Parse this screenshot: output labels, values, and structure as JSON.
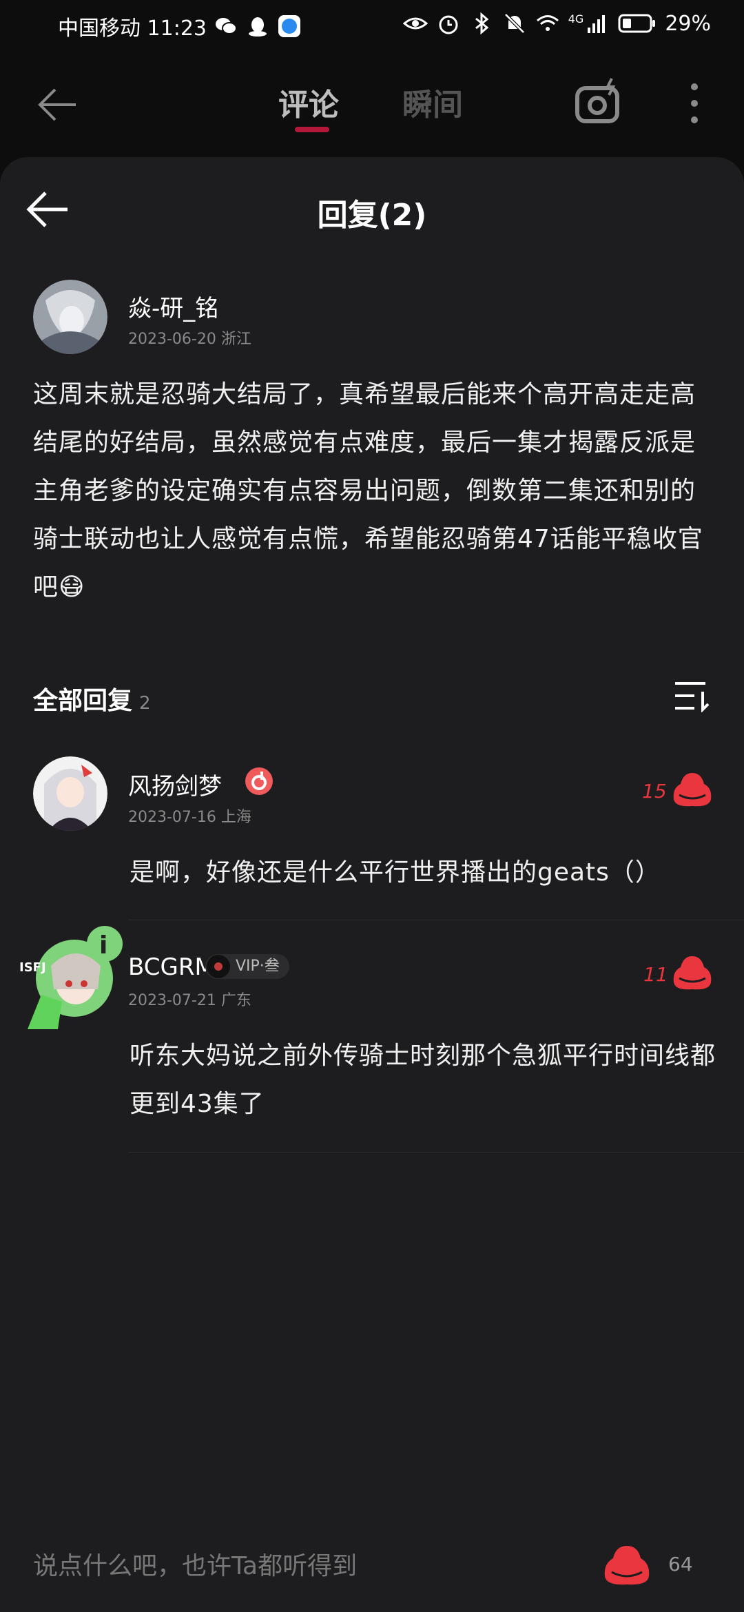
{
  "status_bar": {
    "carrier_time": "中国移动 11:23",
    "signal_label": "4G",
    "battery": "29%"
  },
  "top_nav": {
    "tabs": [
      {
        "label": "评论",
        "active": true
      },
      {
        "label": "瞬间",
        "active": false
      }
    ]
  },
  "panel": {
    "title": "回复(2)"
  },
  "original_comment": {
    "author": "焱-研_铭",
    "date_location": "2023-06-20  浙江",
    "text": "这周末就是忍骑大结局了，真希望最后能来个高开高走走高结尾的好结局，虽然感觉有点难度，最后一集才揭露反派是主角老爹的设定确实有点容易出问题，倒数第二集还和别的骑士联动也让人感觉有点慌，希望能忍骑第47话能平稳收官吧😷"
  },
  "replies_section": {
    "title": "全部回复",
    "count": "2"
  },
  "replies": [
    {
      "author": "风扬剑梦",
      "date_location": "2023-07-16  上海",
      "likes": "15",
      "text": "是啊，好像还是什么平行世界播出的geats（）"
    },
    {
      "author": "BCGRM",
      "vip_label": "VIP·叁",
      "avatar_badge": "ISFJ",
      "date_location": "2023-07-21  广东",
      "likes": "11",
      "text": "听东大妈说之前外传骑士时刻那个急狐平行时间线都更到43集了"
    }
  ],
  "bottom_bar": {
    "input_placeholder": "说点什么吧，也许Ta都听得到",
    "like_count": "64"
  },
  "colors": {
    "accent": "#e9363f",
    "tab_indicator": "#b3183a",
    "panel_bg": "#1d1d1f"
  }
}
